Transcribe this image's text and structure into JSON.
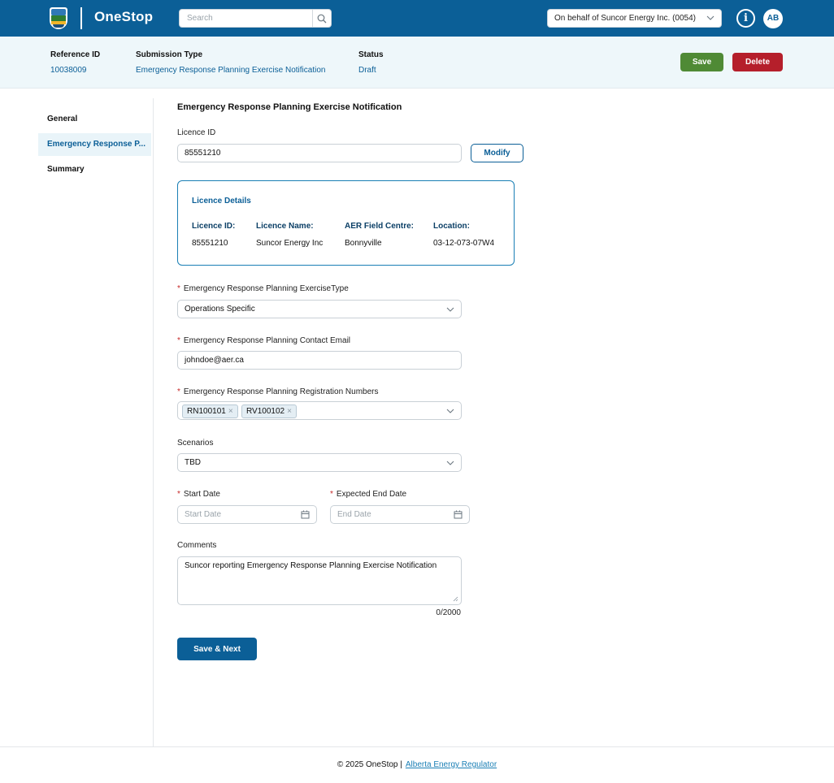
{
  "header": {
    "brand": "OneStop",
    "search_placeholder": "Search",
    "behalf": "On behalf of Suncor Energy Inc. (0054)",
    "info_glyph": "i",
    "avatar_initials": "AB",
    "icons": {
      "logo": "alberta-logo-icon",
      "search": "search-icon",
      "dropdown": "chevron-down-icon",
      "info": "info-icon"
    }
  },
  "submission": {
    "reference_label": "Reference ID",
    "reference_value": "10038009",
    "type_label": "Submission Type",
    "type_value": "Emergency Response Planning Exercise Notification",
    "status_label": "Status",
    "status_value": "Draft",
    "save_label": "Save",
    "delete_label": "Delete",
    "colors": {
      "save": "#4f8a35",
      "delete": "#b51f2b",
      "accent": "#0b5f97"
    }
  },
  "sidebar": {
    "items": [
      {
        "label": "General",
        "active": false
      },
      {
        "label": "Emergency Response P...",
        "active": true
      },
      {
        "label": "Summary",
        "active": false
      }
    ]
  },
  "form": {
    "title": "Emergency Response Planning Exercise Notification",
    "licence_id_label": "Licence ID",
    "licence_id_value": "85551210",
    "modify_label": "Modify",
    "licence_details": {
      "title": "Licence Details",
      "headers": [
        "Licence ID:",
        "Licence Name:",
        "AER Field Centre:",
        "Location:"
      ],
      "values": [
        "85551210",
        "Suncor Energy Inc",
        "Bonnyville",
        "03-12-073-07W4"
      ]
    },
    "required_marker": "*",
    "exercise_type_label": "Emergency Response Planning ExerciseType",
    "exercise_type_value": "Operations Specific",
    "contact_email_label": "Emergency Response Planning Contact Email",
    "contact_email_value": "johndoe@aer.ca",
    "registration_label": "Emergency Response Planning Registration Numbers",
    "registration_tags": [
      "RN100101",
      "RV100102"
    ],
    "tag_remove_glyph": "×",
    "scenarios_label": "Scenarios",
    "scenarios_value": "TBD",
    "start_date_label": "Start Date",
    "start_date_placeholder": "Start Date",
    "end_date_label": "Expected End Date",
    "end_date_placeholder": "End Date",
    "comments_label": "Comments",
    "comments_value": "Suncor reporting Emergency Response Planning Exercise Notification",
    "comments_counter": "0/2000",
    "save_next_label": "Save & Next"
  },
  "footer": {
    "copyright": "© 2025 OneStop |",
    "link": "Alberta Energy Regulator"
  }
}
